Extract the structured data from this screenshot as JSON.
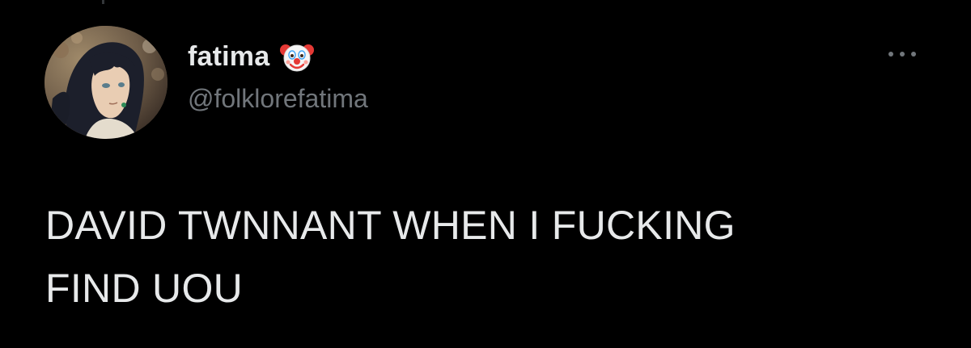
{
  "tweet": {
    "author": {
      "display_name": "fatima",
      "name_emoji_icon": "clown-face-icon",
      "handle": "@folklorefatima",
      "avatar_icon": "anime-character-avatar"
    },
    "more_icon": "more-horizontal-icon",
    "text_lines": [
      "DAVID TWNNANT WHEN I FUCKING",
      "FIND UOU"
    ]
  },
  "colors": {
    "background": "#000000",
    "primary_text": "#e7e9ea",
    "secondary_text": "#71767b"
  }
}
